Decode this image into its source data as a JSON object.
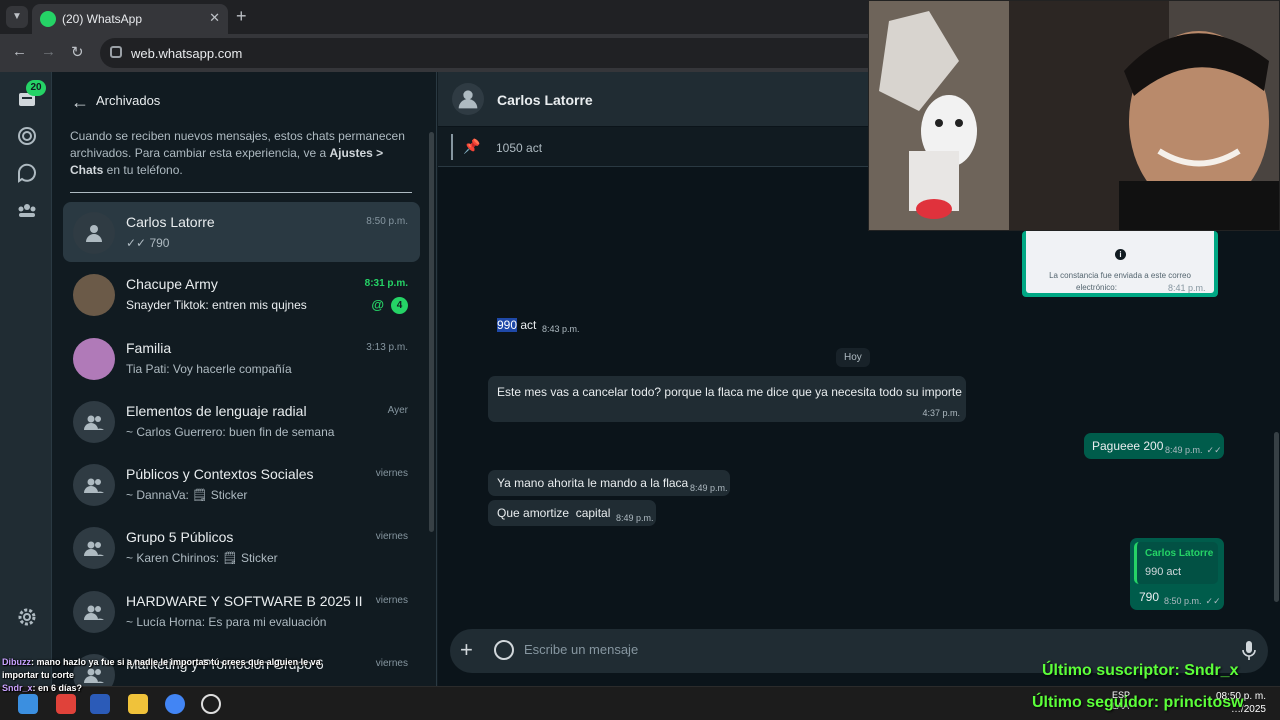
{
  "browser": {
    "tab_title": "(20) WhatsApp",
    "url": "web.whatsapp.com"
  },
  "rail": {
    "chats_badge": "20"
  },
  "archive": {
    "title": "Archivados",
    "info_prefix": "Cuando se reciben nuevos mensajes, estos chats permanecen archivados. Para cambiar esta experiencia, ve a ",
    "info_bold": "Ajustes > Chats",
    "info_suffix": " en tu teléfono."
  },
  "chats": [
    {
      "name": "Carlos Latorre",
      "time": "8:50 p.m.",
      "preview": "✓✓ 790"
    },
    {
      "name": "Chacupe Army",
      "time": "8:31 p.m.",
      "preview": "Snayder Tiktok: entren mis qujnes",
      "mention": "@",
      "badge": "4"
    },
    {
      "name": "Familia",
      "time": "3:13 p.m.",
      "preview": "Tia Pati: Voy hacerle compañía"
    },
    {
      "name": "Elementos de lenguaje radial",
      "time": "Ayer",
      "preview": "~ Carlos Guerrero: buen fin de semana"
    },
    {
      "name": "Públicos y Contextos Sociales",
      "time": "viernes",
      "preview": "~ DannaVa: 🗒 Sticker"
    },
    {
      "name": "Grupo 5 Públicos",
      "time": "viernes",
      "preview": "~ Karen Chirinos: 🗒 Sticker"
    },
    {
      "name": "HARDWARE Y SOFTWARE B 2025 II",
      "time": "viernes",
      "preview": "~ Lucía Horna: Es para mi evaluación"
    },
    {
      "name": "Marketing y Promoción Grupo 6",
      "time": "viernes",
      "preview": ""
    }
  ],
  "conversation": {
    "name": "Carlos Latorre",
    "pinned": "1050 act",
    "receipt": {
      "line1": "La constancia fue enviada a este correo",
      "line2": "electrónico:",
      "time": "8:41 p.m."
    },
    "msg_990": {
      "hl": "990",
      "rest": " act",
      "time": "8:43 p.m."
    },
    "day": "Hoy",
    "msg_cancel": {
      "text": "Este mes vas a cancelar todo? porque la flaca me dice que ya necesita todo su importe",
      "time": "4:37 p.m."
    },
    "msg_paguee": {
      "text": "Pagueee 200",
      "time": "8:49 p.m."
    },
    "msg_mano": {
      "text": "Ya mano ahorita le mando a la flaca",
      "time": "8:49 p.m."
    },
    "msg_amortize": {
      "text": "Que amortize  capital",
      "time": "8:49 p.m."
    },
    "msg_reply": {
      "quote_name": "Carlos Latorre",
      "quote_text": "990 act",
      "text": "790",
      "time": "8:50 p.m."
    },
    "composer_placeholder": "Escribe un mensaje"
  },
  "stream": {
    "chat_lines": [
      {
        "user": "Dibuzz",
        "text": ": mano hazlo ya fue si a nadie le importas tú crees que alguien le va importar tu corte"
      },
      {
        "user": "Sndr_x",
        "text": ": en 6 días?"
      }
    ],
    "subscriber": "Último suscriptor: Sndr_x",
    "follower": "Último seguidor: princitosw"
  },
  "taskbar": {
    "lang": "ESP",
    "lang2": "LAA",
    "time": "08:50 p. m.",
    "date": "…/2025"
  }
}
